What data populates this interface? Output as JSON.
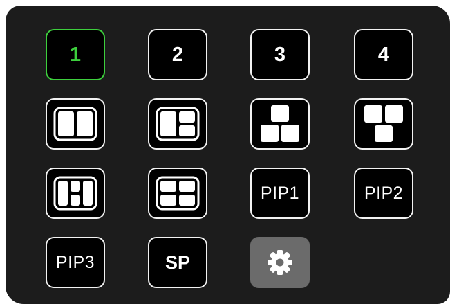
{
  "presets": {
    "items": [
      {
        "label": "1",
        "active": true
      },
      {
        "label": "2",
        "active": false
      },
      {
        "label": "3",
        "active": false
      },
      {
        "label": "4",
        "active": false
      }
    ]
  },
  "layouts": {
    "icons": [
      "layout-split-two-columns-icon",
      "layout-left-large-right-stacked-icon",
      "layout-pyramid-one-top-two-bottom-icon",
      "layout-inverted-pyramid-two-top-one-bottom-icon",
      "layout-three-columns-middle-split-icon",
      "layout-quad-grid-icon"
    ]
  },
  "pip": {
    "pip1_label": "PIP1",
    "pip2_label": "PIP2",
    "pip3_label": "PIP3"
  },
  "sp_label": "SP",
  "settings_icon": "gear-icon",
  "colors": {
    "panel_bg": "#1c1c1c",
    "button_bg": "#000000",
    "button_border": "#f2f2f2",
    "active_accent": "#3dcf3d",
    "settings_bg": "#6b6b6b"
  }
}
